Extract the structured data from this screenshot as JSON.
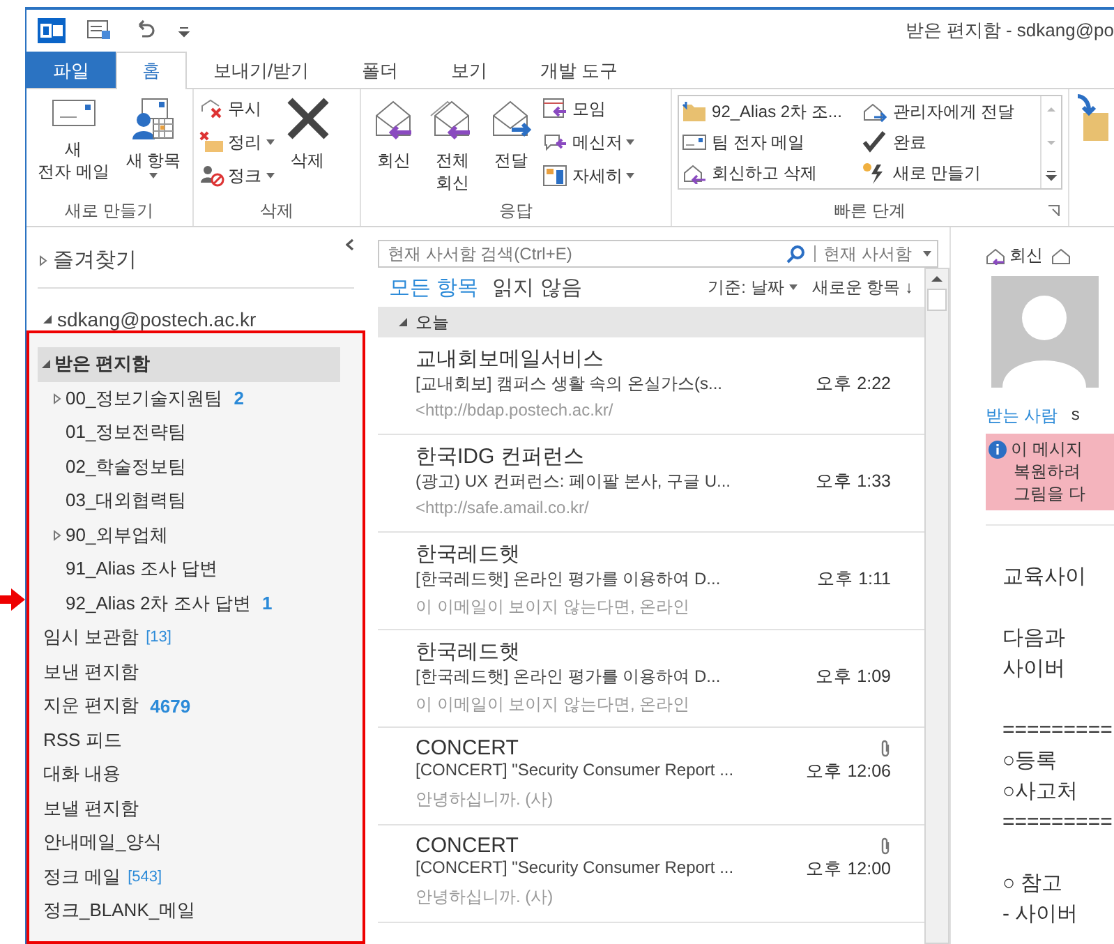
{
  "window": {
    "title": "받은 편지함 - sdkang@po"
  },
  "tabs": [
    {
      "label": "파일",
      "kind": "file",
      "selected": false
    },
    {
      "label": "홈",
      "kind": "tab",
      "selected": true
    },
    {
      "label": "보내기/받기",
      "kind": "tab",
      "selected": false
    },
    {
      "label": "폴더",
      "kind": "tab",
      "selected": false
    },
    {
      "label": "보기",
      "kind": "tab",
      "selected": false
    },
    {
      "label": "개발 도구",
      "kind": "tab",
      "selected": false
    }
  ],
  "ribbon": {
    "new_group": {
      "label": "새로 만들기",
      "new_mail": [
        "새",
        "전자 메일"
      ],
      "new_items": "새 항목"
    },
    "delete_group": {
      "label": "삭제",
      "small": [
        {
          "label": "무시",
          "dropdown": false
        },
        {
          "label": "정리",
          "dropdown": true
        },
        {
          "label": "정크",
          "dropdown": true
        }
      ],
      "delete": "삭제"
    },
    "respond_group": {
      "label": "응답",
      "large": [
        {
          "lines": [
            "회신"
          ]
        },
        {
          "lines": [
            "전체",
            "회신"
          ]
        },
        {
          "lines": [
            "전달"
          ]
        }
      ],
      "small": [
        {
          "label": "모임",
          "dropdown": false
        },
        {
          "label": "메신저",
          "dropdown": true
        },
        {
          "label": "자세히",
          "dropdown": true
        }
      ]
    },
    "quick_steps": {
      "label": "빠른 단계",
      "items": [
        {
          "label": "92_Alias 2차 조..."
        },
        {
          "label": "관리자에게 전달"
        },
        {
          "label": "팀 전자 메일"
        },
        {
          "label": "완료"
        },
        {
          "label": "회신하고 삭제"
        },
        {
          "label": "새로 만들기"
        }
      ]
    }
  },
  "folder_pane": {
    "favorites": {
      "label": "즐겨찾기",
      "expanded": false
    },
    "account": {
      "label": "sdkang@postech.ac.kr",
      "expanded": true
    },
    "folders": [
      {
        "name": "받은 편지함",
        "expanded": true,
        "selected": true,
        "children": [
          {
            "name": "00_정보기술지원팀",
            "expanded": false,
            "selected": false,
            "count": "2",
            "unread": true
          },
          {
            "name": "01_정보전략팀",
            "selected": false
          },
          {
            "name": "02_학술정보팀",
            "selected": false
          },
          {
            "name": "03_대외협력팀",
            "selected": false
          },
          {
            "name": "90_외부업체",
            "expanded": false,
            "selected": false
          },
          {
            "name": "91_Alias 조사 답변",
            "selected": false
          },
          {
            "name": "92_Alias 2차 조사 답변",
            "selected": false,
            "count": "1",
            "unread": true
          }
        ]
      },
      {
        "name": "임시 보관함",
        "selected": false,
        "count": "[13]",
        "unread": false
      },
      {
        "name": "보낸 편지함",
        "selected": false
      },
      {
        "name": "지운 편지함",
        "selected": false,
        "count": "4679",
        "unread": true
      },
      {
        "name": "RSS 피드",
        "selected": false
      },
      {
        "name": "대화 내용",
        "selected": false
      },
      {
        "name": "보낼 편지함",
        "selected": false
      },
      {
        "name": "안내메일_양식",
        "selected": false
      },
      {
        "name": "정크 메일",
        "selected": false,
        "count": "[543]",
        "unread": false
      },
      {
        "name": "정크_BLANK_메일",
        "selected": false
      }
    ]
  },
  "message_list": {
    "search": {
      "placeholder": "현재 사서함 검색(Ctrl+E)",
      "scope": "현재 사서함"
    },
    "filters": [
      {
        "label": "모든 항목",
        "selected": true
      },
      {
        "label": "읽지 않음",
        "selected": false
      }
    ],
    "sort": "기준: 날짜",
    "order": "새로운 항목 ↓",
    "group": {
      "label": "오늘",
      "expanded": true
    },
    "messages": [
      {
        "sender": "교내회보메일서비스",
        "subject": "[교내회보] 캠퍼스 생활 속의 온실가스(s...",
        "time": "오후 2:22",
        "preview": "<http://bdap.postech.ac.kr/",
        "attachment": false
      },
      {
        "sender": "한국IDG 컨퍼런스",
        "subject": "(광고) UX 컨퍼런스: 페이팔 본사, 구글 U...",
        "time": "오후 1:33",
        "preview": "<http://safe.amail.co.kr/",
        "attachment": false
      },
      {
        "sender": "한국레드햇",
        "subject": "[한국레드햇] 온라인 평가를 이용하여 D...",
        "time": "오후 1:11",
        "preview": "이 이메일이 보이지 않는다면, 온라인",
        "attachment": false
      },
      {
        "sender": "한국레드햇",
        "subject": "[한국레드햇] 온라인 평가를 이용하여 D...",
        "time": "오후 1:09",
        "preview": "이 이메일이 보이지 않는다면, 온라인",
        "attachment": false
      },
      {
        "sender": "CONCERT",
        "subject": "[CONCERT] \"Security Consumer Report ...",
        "time": "오후 12:06",
        "preview": "안녕하십니까. (사)",
        "attachment": true
      },
      {
        "sender": "CONCERT",
        "subject": "[CONCERT] \"Security Consumer Report ...",
        "time": "오후 12:00",
        "preview": "안녕하십니까. (사)",
        "attachment": true
      }
    ]
  },
  "reading_pane": {
    "reply": "회신",
    "to_label": "받는 사람",
    "to": "s",
    "info": [
      "이 메시지",
      "복원하려",
      "그림을 다"
    ],
    "body": [
      [
        "교육사이"
      ],
      [
        "다음과",
        "사이버"
      ],
      [
        "=========",
        "○등록",
        "○사고처",
        "========="
      ],
      [
        "○ 참고",
        "- 사이버"
      ]
    ]
  }
}
